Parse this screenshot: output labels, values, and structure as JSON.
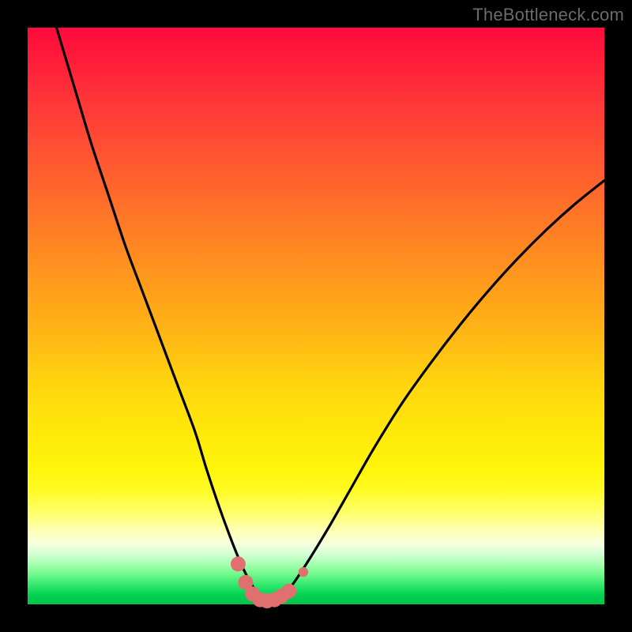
{
  "watermark": "TheBottleneck.com",
  "colors": {
    "frame": "#000000",
    "curve": "#000000",
    "marker": "#e07070",
    "marker_stroke": "#c85a5a"
  },
  "chart_data": {
    "type": "line",
    "title": "",
    "xlabel": "",
    "ylabel": "",
    "xlim": [
      0,
      100
    ],
    "ylim": [
      0,
      100
    ],
    "grid": false,
    "legend": false,
    "series": [
      {
        "name": "bottleneck-curve",
        "x": [
          5,
          8,
          11,
          14,
          17,
          20,
          23,
          26,
          29,
          31,
          33,
          35,
          36.8,
          38.5,
          40,
          41.5,
          43,
          45,
          48,
          52,
          56,
          60,
          65,
          70,
          75,
          80,
          85,
          90,
          95,
          100
        ],
        "y": [
          100,
          90,
          80,
          71,
          62,
          54,
          46,
          38,
          30,
          23.5,
          17.5,
          12,
          7.5,
          4,
          1.8,
          0.6,
          0.6,
          2.2,
          6.5,
          13,
          20,
          27,
          35,
          42,
          48.5,
          54.5,
          60,
          65,
          69.5,
          73.5
        ]
      }
    ],
    "markers": {
      "name": "highlight-cluster",
      "x": [
        36.5,
        37.8,
        39.0,
        40.3,
        41.5,
        42.8,
        44.0,
        45.3,
        47.8
      ],
      "y": [
        7.0,
        3.8,
        1.8,
        0.8,
        0.6,
        0.8,
        1.4,
        2.3,
        5.6
      ],
      "r": [
        1.3,
        1.3,
        1.3,
        1.3,
        1.3,
        1.3,
        1.3,
        1.3,
        0.85
      ]
    }
  }
}
